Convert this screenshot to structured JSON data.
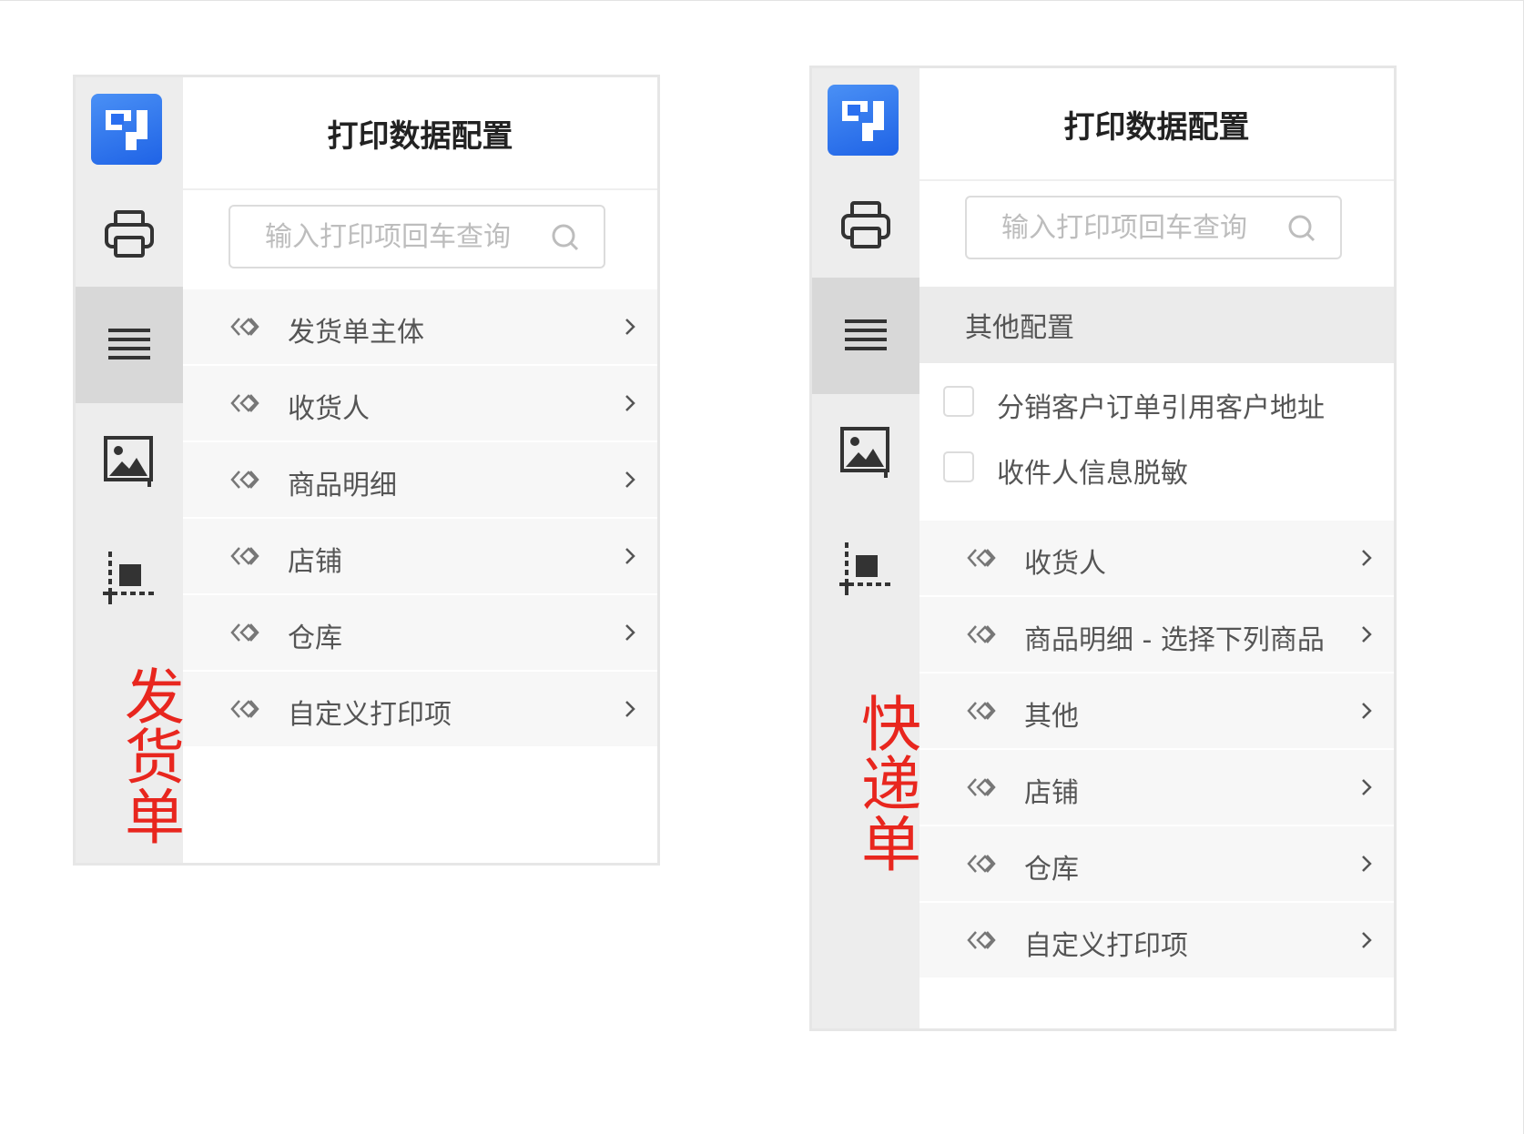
{
  "panels": [
    {
      "rail_label": "发货单",
      "title": "打印数据配置",
      "search_placeholder": "输入打印项回车查询",
      "items": [
        {
          "label": "发货单主体"
        },
        {
          "label": "收货人"
        },
        {
          "label": "商品明细"
        },
        {
          "label": "店铺"
        },
        {
          "label": "仓库"
        },
        {
          "label": "自定义打印项"
        }
      ]
    },
    {
      "rail_label": "快递单",
      "title": "打印数据配置",
      "search_placeholder": "输入打印项回车查询",
      "section_header": "其他配置",
      "checkboxes": [
        {
          "label": "分销客户订单引用客户地址",
          "checked": false
        },
        {
          "label": "收件人信息脱敏",
          "checked": false
        }
      ],
      "items": [
        {
          "label": "收货人"
        },
        {
          "label": "商品明细 - 选择下列商品"
        },
        {
          "label": "其他"
        },
        {
          "label": "店铺"
        },
        {
          "label": "仓库"
        },
        {
          "label": "自定义打印项"
        }
      ]
    }
  ],
  "icons": {
    "logo": "app-logo-icon",
    "rail": [
      "printer-icon",
      "list-icon",
      "image-icon",
      "crop-icon"
    ],
    "item": "link-icon",
    "chevron": "chevron-right-icon",
    "search": "search-icon"
  },
  "colors": {
    "rail_bg": "#ededed",
    "rail_active": "#d8d8d8",
    "label_red": "#e8261e",
    "logo_blue": "#2a6ff0",
    "item_bg": "#f7f7f7"
  }
}
